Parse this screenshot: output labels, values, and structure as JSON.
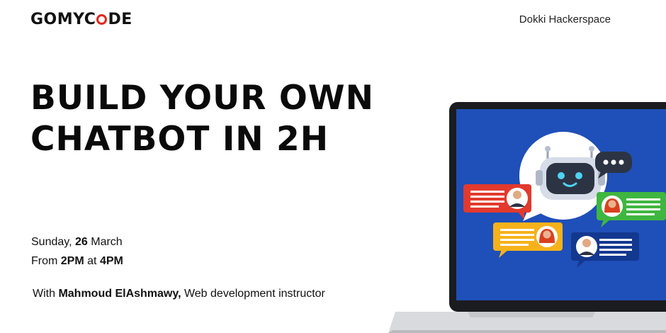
{
  "brand": {
    "logo_prefix": "GOMYC",
    "logo_suffix": "DE",
    "accent_color": "#e2261c"
  },
  "location": "Dokki Hackerspace",
  "headline": {
    "line1": "BUILD YOUR OWN",
    "line2": "CHATBOT IN 2H"
  },
  "schedule": {
    "day": "Sunday,",
    "date": "26",
    "month": "March",
    "from_label": "From",
    "start": "2PM",
    "at_label": "at",
    "end": "4PM"
  },
  "speaker": {
    "with_label": "With",
    "name": "Mahmoud ElAshmawy,",
    "role": "Web development instructor"
  },
  "illustration": {
    "icons": [
      "laptop-icon",
      "robot-icon",
      "chat-bubble-icon",
      "user-avatar-icon"
    ],
    "screen_color": "#1f4fb8",
    "bubble_colors": [
      "#e23a2e",
      "#3fb640",
      "#f6b21b",
      "#13388f"
    ]
  }
}
